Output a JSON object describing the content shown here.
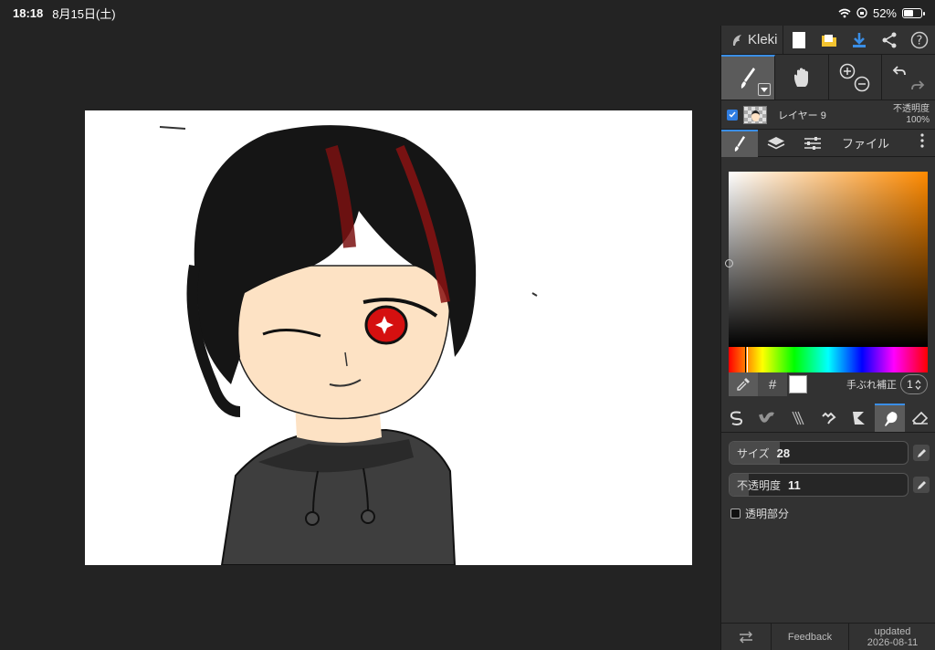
{
  "status": {
    "time": "18:18",
    "date": "8月15日(土)",
    "battery": "52%"
  },
  "app": {
    "logo": "Kleki"
  },
  "topbar": {
    "icons": [
      "new-image-icon",
      "open-file-icon",
      "download-icon",
      "share-icon",
      "help-icon"
    ]
  },
  "tools": [
    "brush-icon",
    "hand-icon",
    "zoom-icon",
    "undo-redo-icon"
  ],
  "layer": {
    "name": "レイヤー 9",
    "opacity_label": "不透明度",
    "opacity_value": "100%"
  },
  "tabs": {
    "file_label": "ファイル"
  },
  "color": {
    "current": "#ffffff",
    "hue_color": "#ff8a00",
    "hash": "#"
  },
  "stabilizer": {
    "label": "手ぶれ補正",
    "value": "1"
  },
  "brush": {
    "size_label": "サイズ",
    "size_value": "28",
    "size_fraction": 0.28,
    "opacity_label": "不透明度",
    "opacity_value": "11",
    "opacity_fraction": 0.11,
    "transparent_label": "透明部分"
  },
  "bottom": {
    "feedback": "Feedback",
    "updated_label": "updated",
    "updated_date": "2026-08-11"
  },
  "colors": {
    "accent": "#3a8ee6",
    "panel": "#323232",
    "background": "#232323"
  }
}
